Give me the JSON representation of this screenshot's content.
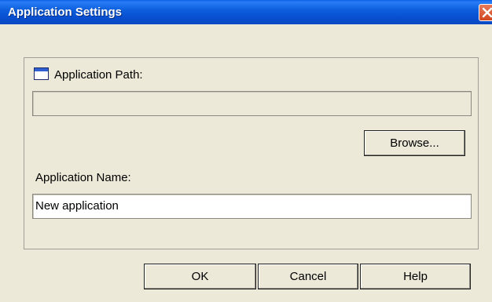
{
  "window": {
    "title": "Application Settings"
  },
  "icons": {
    "close": "close-icon",
    "path": "window-icon"
  },
  "colors": {
    "titlebar": "#0a5fe6",
    "dialog_bg": "#ece9d8",
    "close_button": "#d2471e"
  },
  "path_section": {
    "label": "Application Path:",
    "value": ""
  },
  "browse_button": {
    "label": "Browse..."
  },
  "name_section": {
    "label": "Application Name:",
    "value": "New application"
  },
  "footer": {
    "ok_label": "OK",
    "cancel_label": "Cancel",
    "help_label": "Help"
  }
}
